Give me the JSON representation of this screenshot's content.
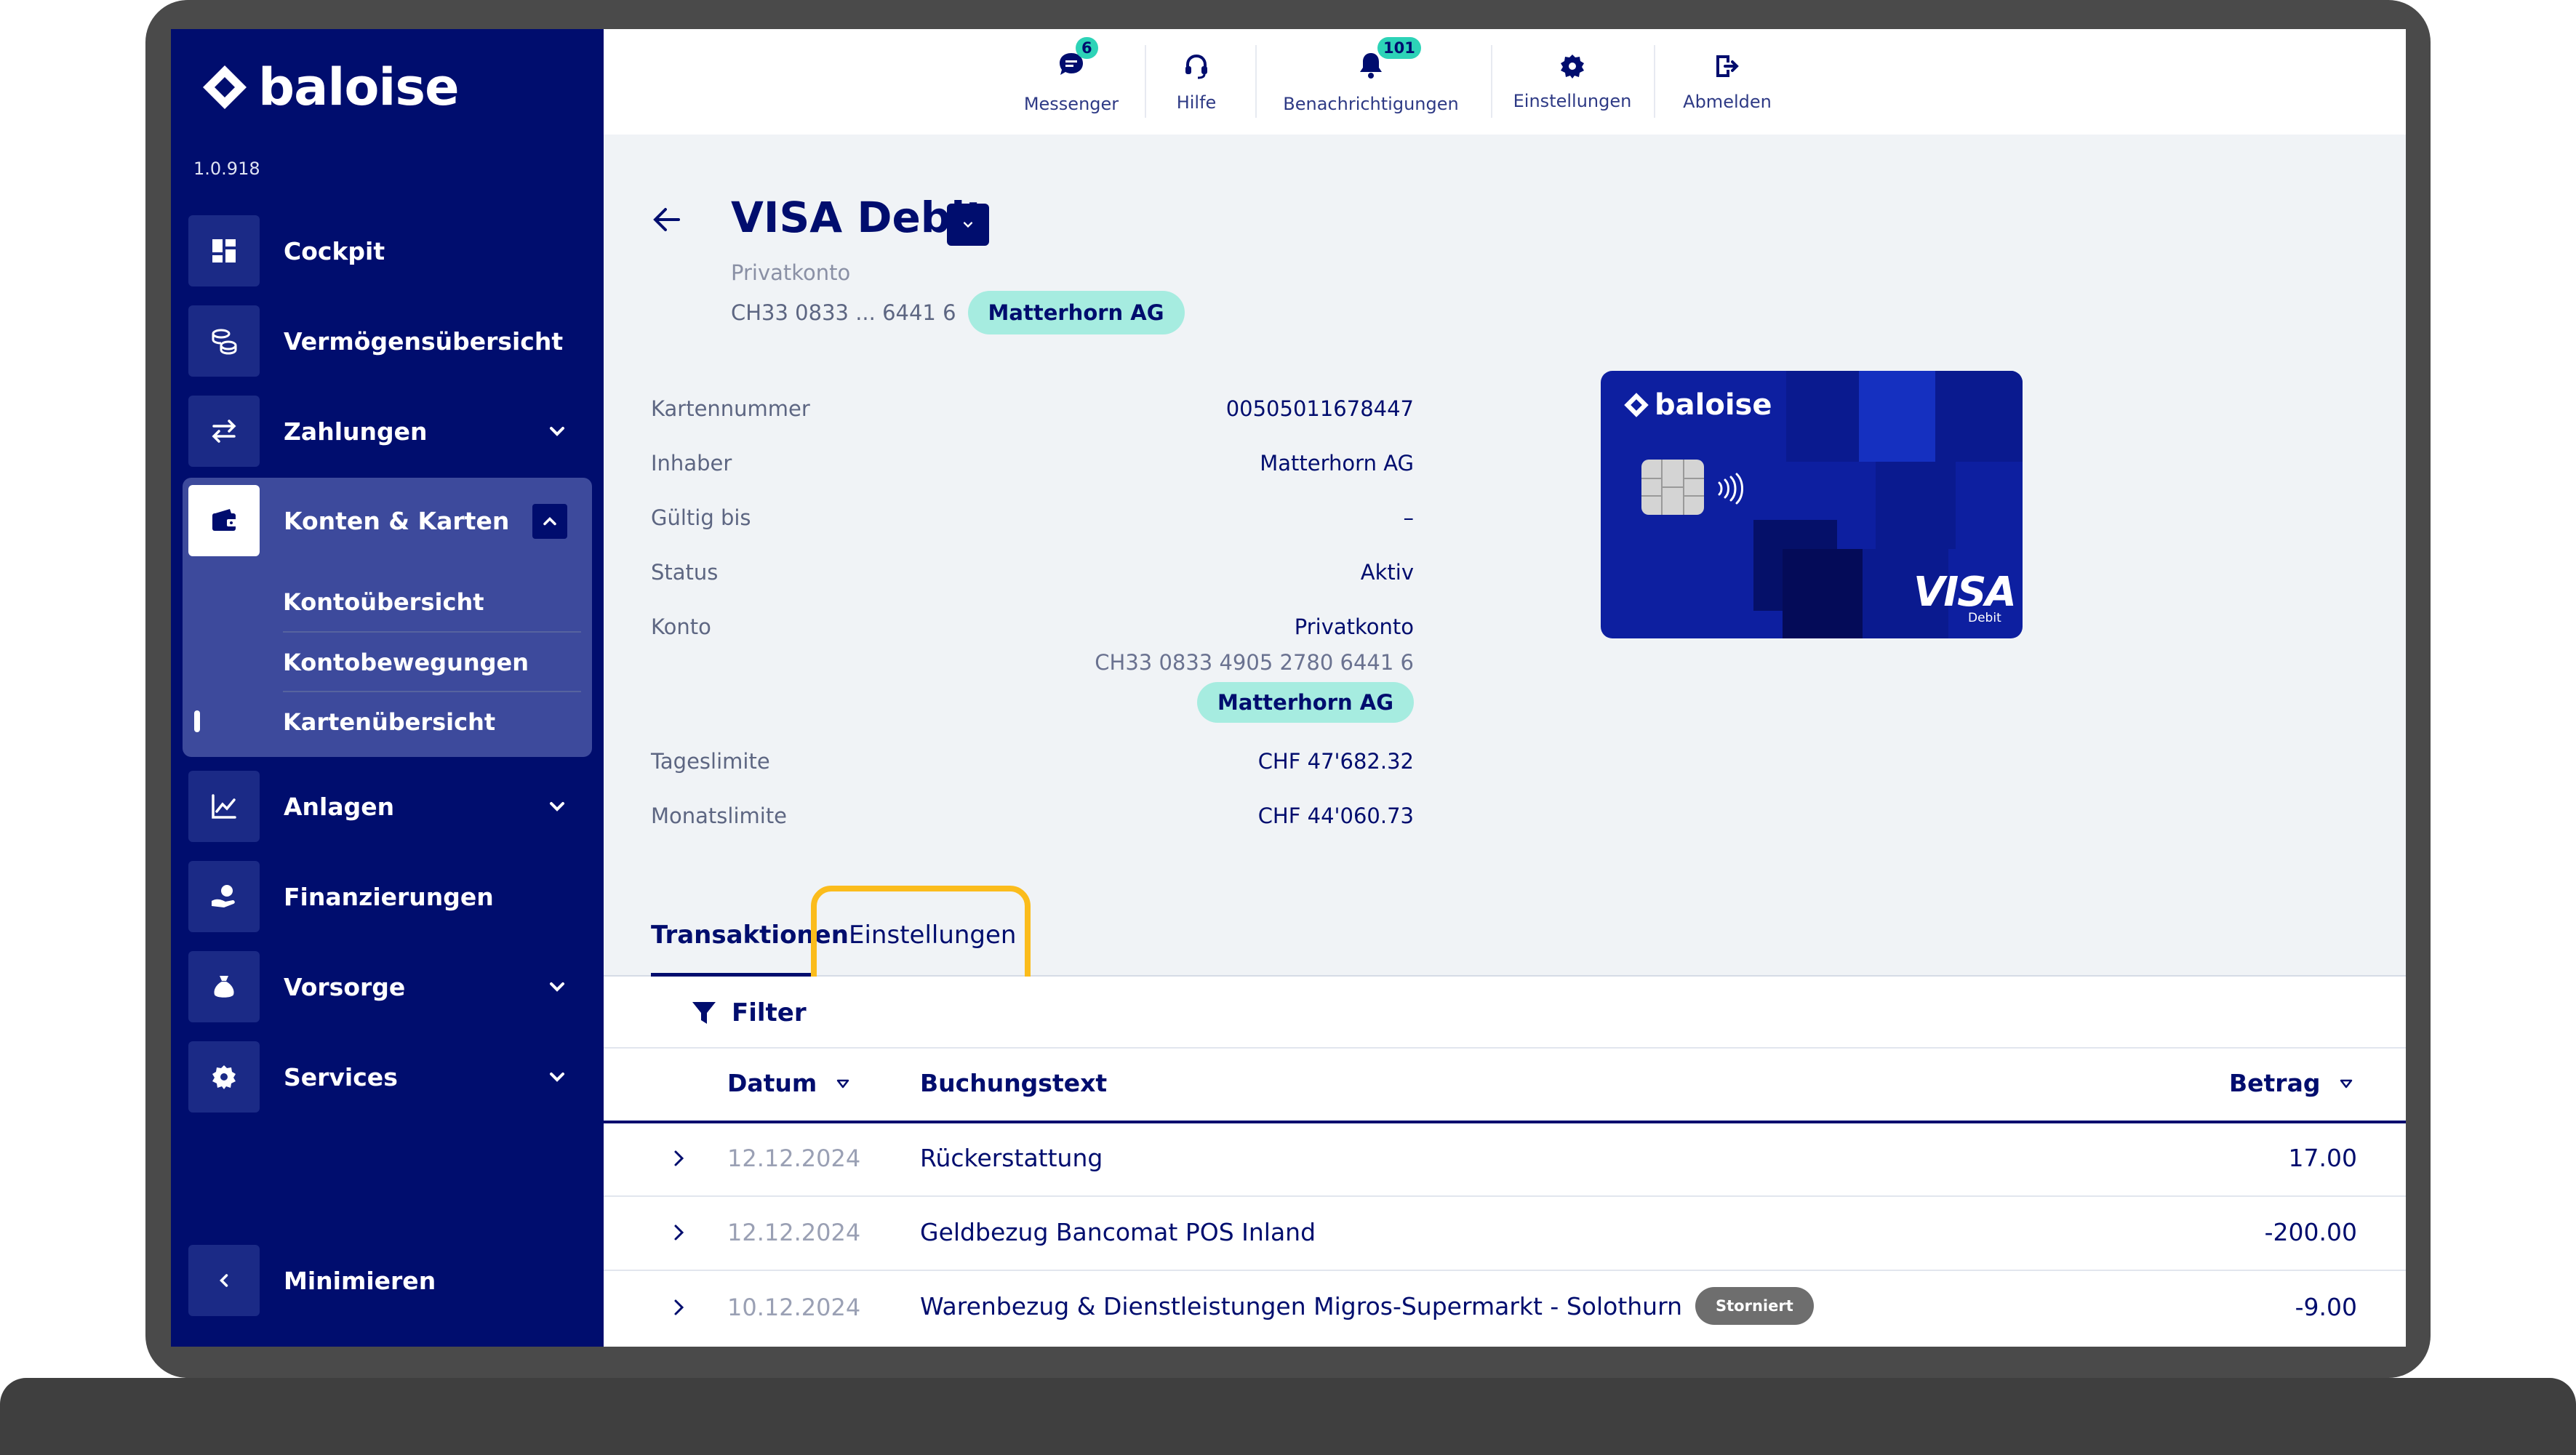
{
  "sidebar": {
    "logo_text": "baloise",
    "version": "1.0.918",
    "items": [
      {
        "label": "Cockpit"
      },
      {
        "label": "Vermögensübersicht"
      },
      {
        "label": "Zahlungen"
      },
      {
        "label": "Konten & Karten"
      },
      {
        "label": "Anlagen"
      },
      {
        "label": "Finanzierungen"
      },
      {
        "label": "Vorsorge"
      },
      {
        "label": "Services"
      }
    ],
    "sub_items": [
      {
        "label": "Kontoübersicht"
      },
      {
        "label": "Kontobewegungen"
      },
      {
        "label": "Kartenübersicht"
      }
    ],
    "minimize_label": "Minimieren"
  },
  "header": {
    "messenger": {
      "label": "Messenger",
      "badge": "6"
    },
    "help": {
      "label": "Hilfe"
    },
    "notifications": {
      "label": "Benachrichtigungen",
      "badge": "101"
    },
    "settings": {
      "label": "Einstellungen"
    },
    "logout": {
      "label": "Abmelden"
    }
  },
  "account": {
    "title": "VISA Debit",
    "type": "Privatkonto",
    "iban_short": "CH33 0833 ... 6441 6",
    "holder_pill": "Matterhorn AG"
  },
  "details": [
    {
      "label": "Kartennummer",
      "value": "00505011678447"
    },
    {
      "label": "Inhaber",
      "value": "Matterhorn AG"
    },
    {
      "label": "Gültig bis",
      "value": "–"
    },
    {
      "label": "Status",
      "value": "Aktiv"
    },
    {
      "label": "Konto",
      "value": "Privatkonto",
      "sub": "CH33 0833 4905 2780 6441 6",
      "pill": "Matterhorn AG"
    },
    {
      "label": "Tageslimite",
      "value": "CHF 47'682.32"
    },
    {
      "label": "Monatslimite",
      "value": "CHF 44'060.73"
    }
  ],
  "card": {
    "brand": "baloise",
    "network": "VISA",
    "network_sub": "Debit"
  },
  "tabs": [
    {
      "label": "Transaktionen",
      "active": true
    },
    {
      "label": "Einstellungen",
      "active": false
    }
  ],
  "table": {
    "filter_label": "Filter",
    "columns": [
      "Datum",
      "Buchungstext",
      "Betrag"
    ],
    "rows": [
      {
        "date": "12.12.2024",
        "text": "Rückerstattung",
        "amount": "17.00"
      },
      {
        "date": "12.12.2024",
        "text": "Geldbezug Bancomat POS Inland",
        "amount": "-200.00"
      },
      {
        "date": "10.12.2024",
        "text": "Warenbezug & Dienstleistungen Migros-Supermarkt - Solothurn",
        "amount": "-9.00",
        "badge": "Storniert"
      }
    ]
  },
  "colors": {
    "primary": "#000d6e",
    "accent": "#2dd3b7",
    "pill": "#a6ece0",
    "highlight": "#fbbc1c",
    "card": "#0d1fa0"
  }
}
